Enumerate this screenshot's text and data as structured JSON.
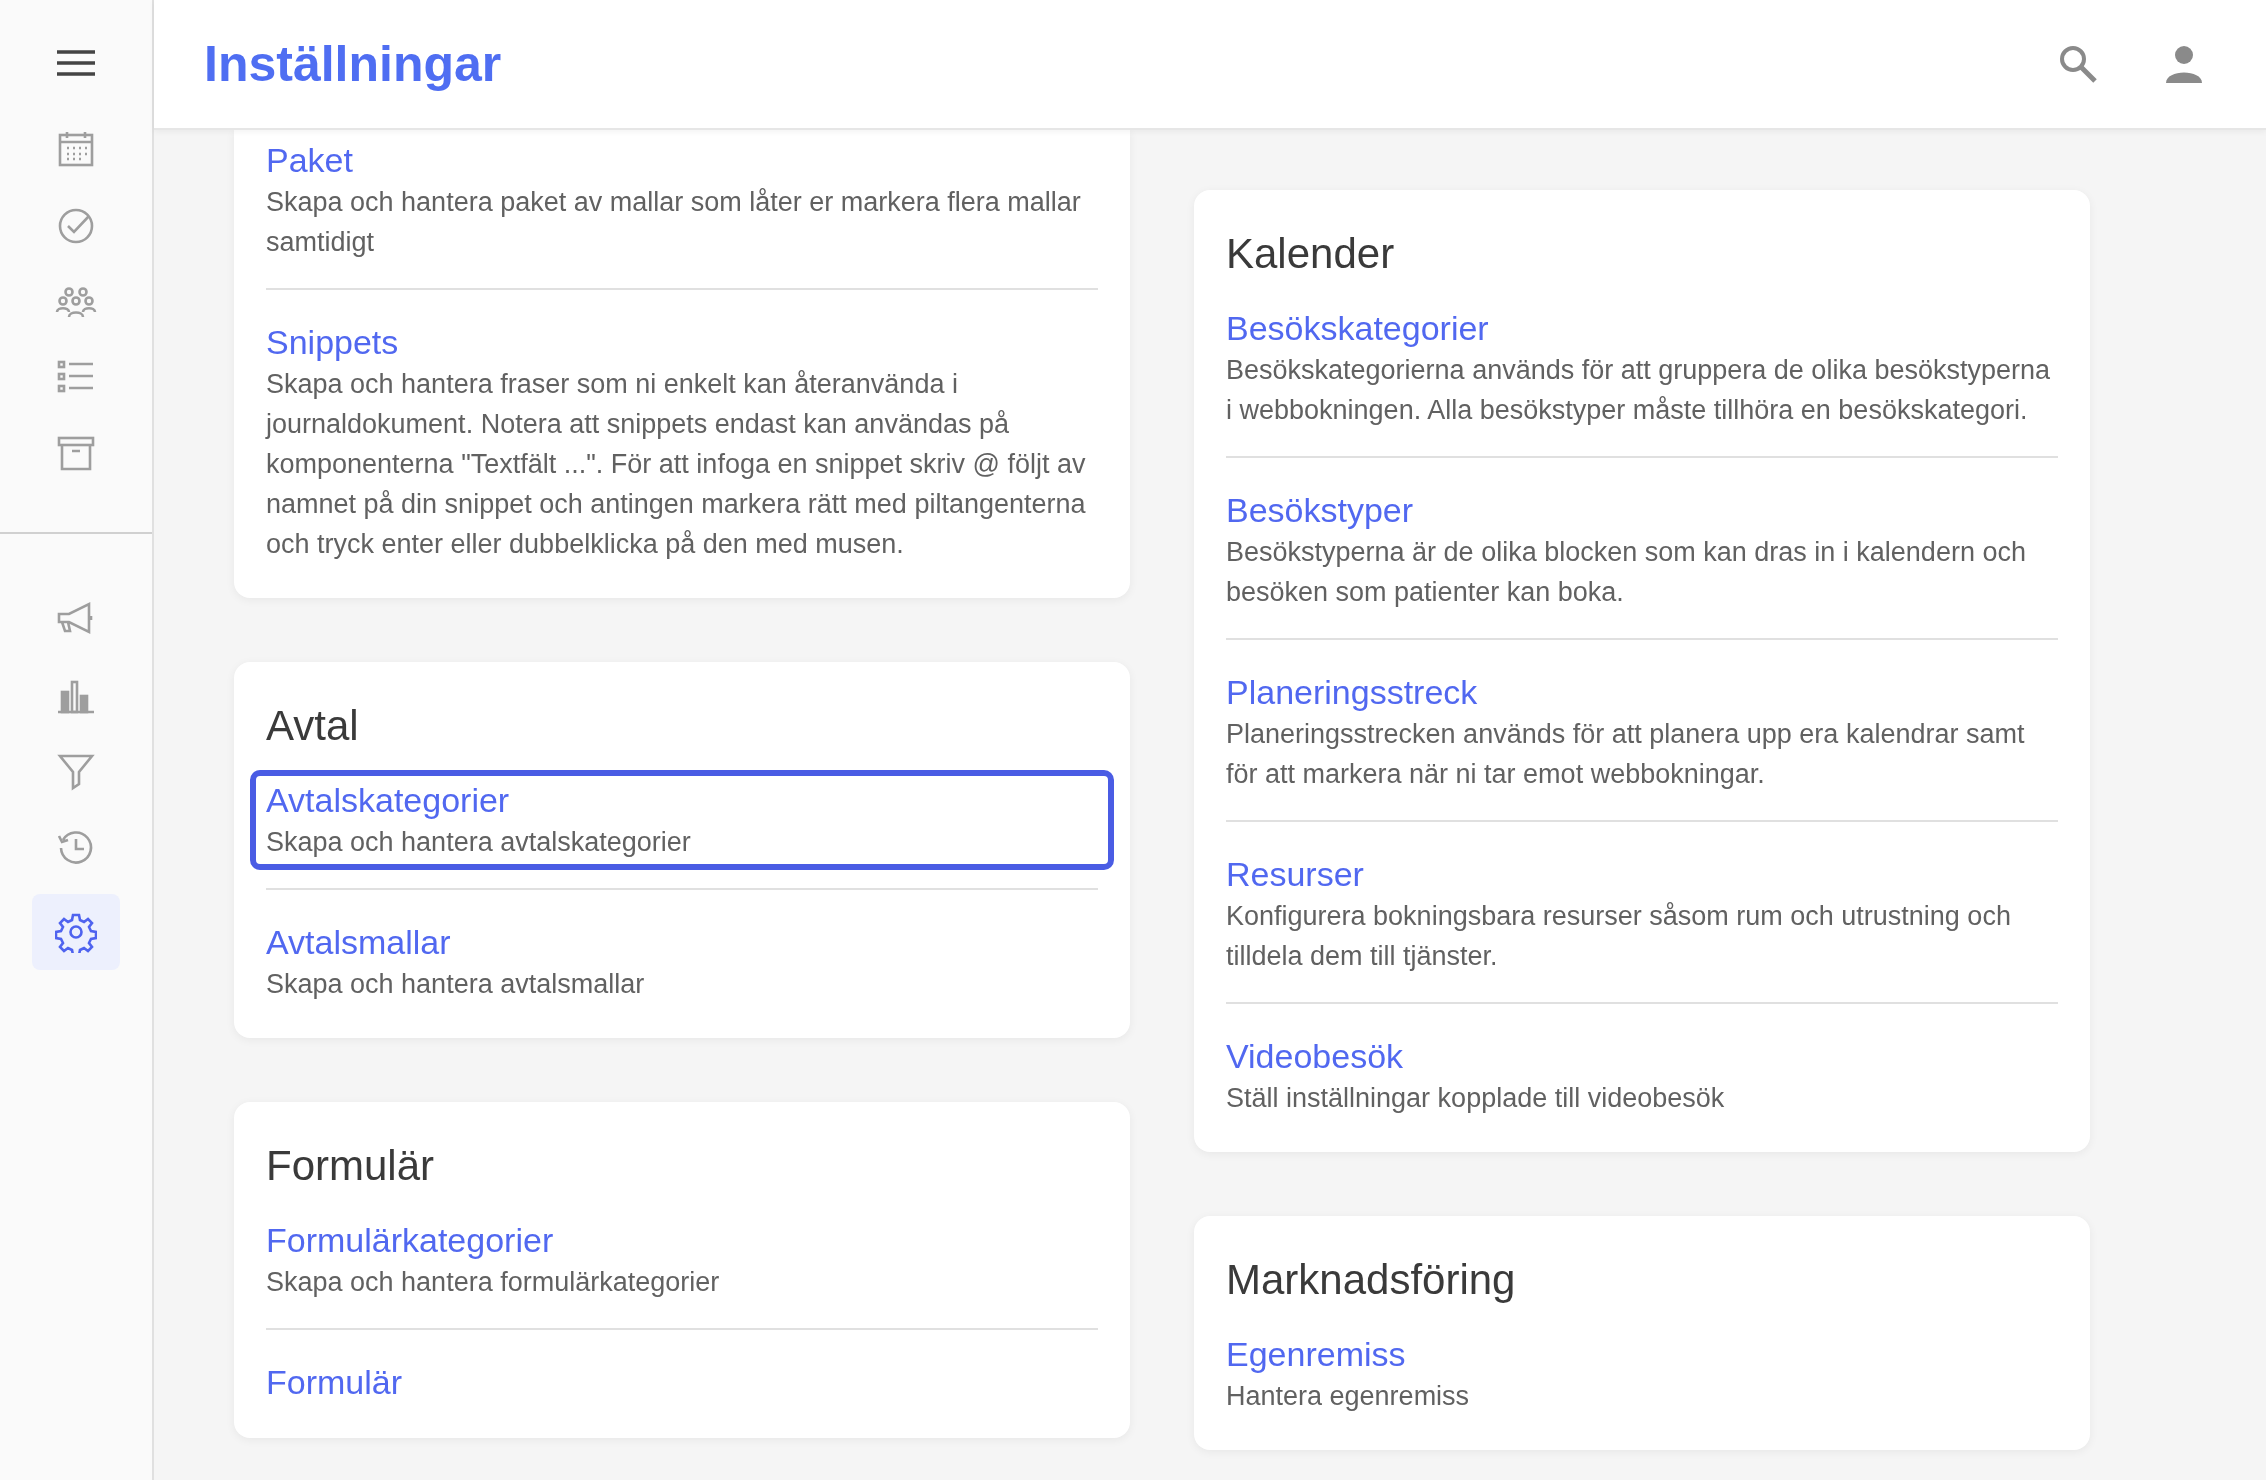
{
  "header": {
    "title": "Inställningar"
  },
  "sidebar": {
    "top_items": [
      {
        "kind": "calendar",
        "selected": false
      },
      {
        "kind": "check",
        "selected": false
      },
      {
        "kind": "people",
        "selected": false
      },
      {
        "kind": "list",
        "selected": false
      },
      {
        "kind": "archive",
        "selected": false
      }
    ],
    "bottom_items": [
      {
        "kind": "megaphone",
        "selected": false
      },
      {
        "kind": "chart",
        "selected": false
      },
      {
        "kind": "filter",
        "selected": false
      },
      {
        "kind": "history",
        "selected": false
      },
      {
        "kind": "settings",
        "selected": true
      }
    ]
  },
  "columns": [
    [
      {
        "items": [
          {
            "title": "Paket",
            "description": "Skapa och hantera paket av mallar som låter er markera flera mallar samtidigt",
            "focused": false
          },
          {
            "title": "Snippets",
            "description": "Skapa och hantera fraser som ni enkelt kan återanvända i journaldokument. Notera att snippets endast kan användas på komponenterna \"Textfält ...\". För att infoga en snippet skriv @ följt av namnet på din snippet och antingen markera rätt med piltangenterna och tryck enter eller dubbelklicka på den med musen.",
            "focused": false
          }
        ]
      },
      {
        "title": "Avtal",
        "items": [
          {
            "title": "Avtalskategorier",
            "description": "Skapa och hantera avtalskategorier",
            "focused": true
          },
          {
            "title": "Avtalsmallar",
            "description": "Skapa och hantera avtalsmallar",
            "focused": false
          }
        ]
      },
      {
        "title": "Formulär",
        "items": [
          {
            "title": "Formulärkategorier",
            "description": "Skapa och hantera formulärkategorier",
            "focused": false
          },
          {
            "title": "Formulär",
            "focused": false
          }
        ]
      }
    ],
    [
      {
        "title": "Kalender",
        "items": [
          {
            "title": "Besökskategorier",
            "description": "Besökskategorierna används för att gruppera de olika besökstyperna i webbokningen. Alla besökstyper måste tillhöra en besökskategori.",
            "focused": false
          },
          {
            "title": "Besökstyper",
            "description": "Besökstyperna är de olika blocken som kan dras in i kalendern och besöken som patienter kan boka.",
            "focused": false
          },
          {
            "title": "Planeringsstreck",
            "description": "Planeringsstrecken används för att planera upp era kalendrar samt för att markera när ni tar emot webbokningar.",
            "focused": false
          },
          {
            "title": "Resurser",
            "description": "Konfigurera bokningsbara resurser såsom rum och utrustning och tilldela dem till tjänster.",
            "focused": false
          },
          {
            "title": "Videobesök",
            "description": "Ställ inställningar kopplade till videobesök",
            "focused": false
          }
        ]
      },
      {
        "title": "Marknadsföring",
        "items": [
          {
            "title": "Egenremiss",
            "description": "Hantera egenremiss",
            "focused": false
          }
        ]
      }
    ]
  ]
}
